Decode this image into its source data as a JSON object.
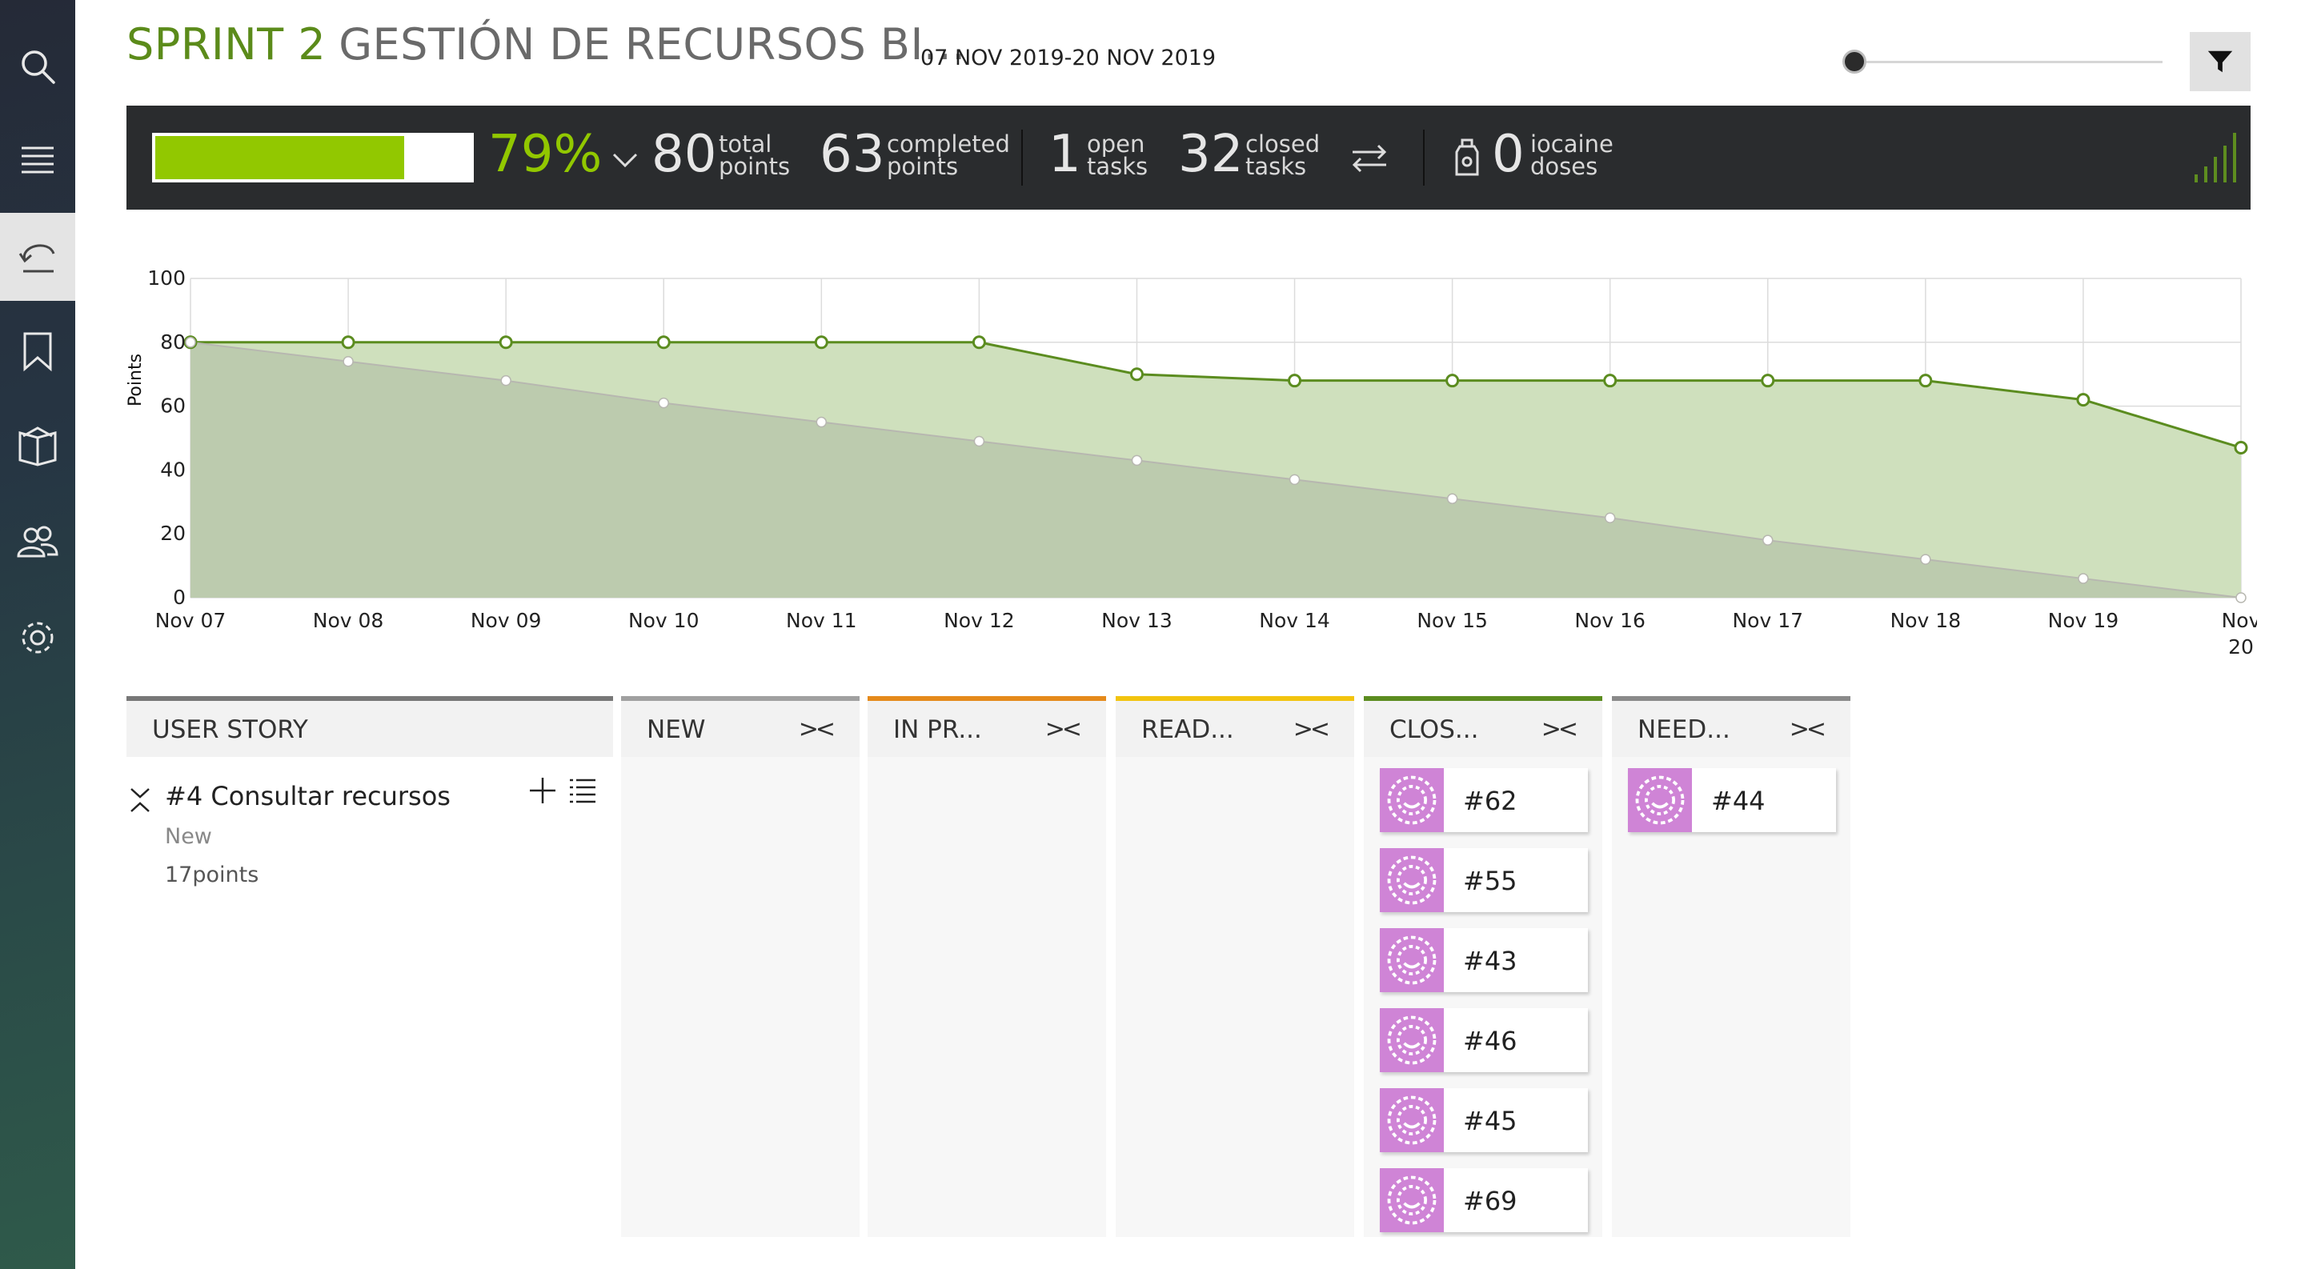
{
  "sprint": {
    "name": "SPRINT 2",
    "project": "GESTIÓN DE RECURSOS BI...",
    "dates": "07 NOV 2019-20 NOV 2019"
  },
  "zoom": {
    "level": 0
  },
  "summary": {
    "progress_percent": 79,
    "percent_label": "79%",
    "total_points": "80",
    "total_label_1": "total",
    "total_label_2": "points",
    "completed_points": "63",
    "completed_label_1": "completed",
    "completed_label_2": "points",
    "open_tasks": "1",
    "open_label_1": "open",
    "open_label_2": "tasks",
    "closed_tasks": "32",
    "closed_label_1": "closed",
    "closed_label_2": "tasks",
    "iocaine_doses": "0",
    "iocaine_label_1": "iocaine",
    "iocaine_label_2": "doses"
  },
  "sidebar": {
    "items": [
      {
        "icon": "search-icon"
      },
      {
        "icon": "backlog-icon"
      },
      {
        "icon": "sprint-icon",
        "active": true
      },
      {
        "icon": "bookmark-icon"
      },
      {
        "icon": "wiki-icon"
      },
      {
        "icon": "team-icon"
      },
      {
        "icon": "gear-icon"
      }
    ]
  },
  "chart_data": {
    "type": "area",
    "ylabel": "Points",
    "ylim": [
      0,
      100
    ],
    "yticks": [
      "0",
      "20",
      "40",
      "60",
      "80",
      "100"
    ],
    "categories": [
      "Nov 07",
      "Nov 08",
      "Nov 09",
      "Nov 10",
      "Nov 11",
      "Nov 12",
      "Nov 13",
      "Nov 14",
      "Nov 15",
      "Nov 16",
      "Nov 17",
      "Nov 18",
      "Nov 19",
      "Nov 20"
    ],
    "series": [
      {
        "values": [
          80,
          80,
          80,
          80,
          80,
          80,
          70,
          68,
          68,
          68,
          68,
          68,
          62,
          47
        ],
        "color": "#5b8c1f",
        "fill": "#cfe0bd"
      },
      {
        "values": [
          80,
          74,
          68,
          61,
          55,
          49,
          43,
          37,
          31,
          25,
          18,
          12,
          6,
          0
        ],
        "color": "#b7b7b0",
        "fill": "#b9c7ac"
      }
    ],
    "grid": true
  },
  "taskboard": {
    "columns": [
      {
        "label": "USER STORY",
        "color": "#777777"
      },
      {
        "label": "NEW",
        "color": "#a0a0a0"
      },
      {
        "label": "IN PR...",
        "color": "#e58a1b"
      },
      {
        "label": "READ...",
        "color": "#f2c40f"
      },
      {
        "label": "CLOS...",
        "color": "#5b8c1f"
      },
      {
        "label": "NEED...",
        "color": "#8a8a8a"
      }
    ],
    "fold_label": "><",
    "user_story": {
      "title": "#4 Consultar recursos",
      "status": "New",
      "points": "17points"
    },
    "closed_tasks": [
      "#62",
      "#55",
      "#43",
      "#46",
      "#45",
      "#69"
    ],
    "needs_info_tasks": [
      "#44"
    ]
  }
}
